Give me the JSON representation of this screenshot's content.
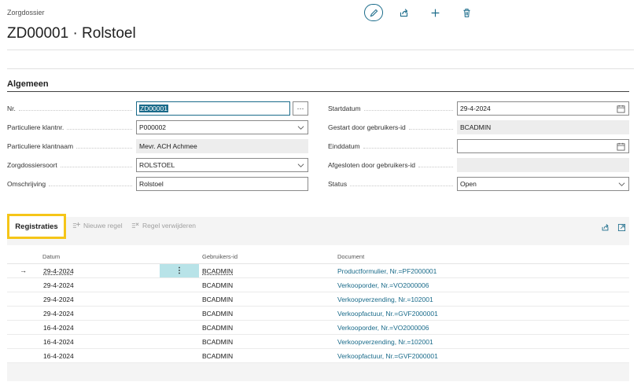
{
  "header": {
    "breadcrumb": "Zorgdossier",
    "title": "ZD00001 · Rolstoel",
    "actions": [
      {
        "icon": "pencil-icon",
        "label": "Bewerken"
      },
      {
        "icon": "share-icon",
        "label": "Delen"
      },
      {
        "icon": "plus-icon",
        "label": "Nieuw"
      },
      {
        "icon": "trash-icon",
        "label": "Verwijderen"
      }
    ]
  },
  "general": {
    "title": "Algemeen",
    "left": [
      {
        "label": "Nr.",
        "value": "ZD00001"
      },
      {
        "label": "Particuliere klantnr.",
        "value": "P000002"
      },
      {
        "label": "Particuliere klantnaam",
        "value": "Mevr. ACH Achmee"
      },
      {
        "label": "Zorgdossiersoort",
        "value": "ROLSTOEL"
      },
      {
        "label": "Omschrijving",
        "value": "Rolstoel"
      }
    ],
    "right": [
      {
        "label": "Startdatum",
        "value": "29-4-2024"
      },
      {
        "label": "Gestart door gebruikers-id",
        "value": "BCADMIN"
      },
      {
        "label": "Einddatum",
        "value": ""
      },
      {
        "label": "Afgesloten door gebruikers-id",
        "value": ""
      },
      {
        "label": "Status",
        "value": "Open"
      }
    ],
    "more_label": "···"
  },
  "registraties": {
    "tab_label": "Registraties",
    "new_line_label": "Nieuwe regel",
    "delete_line_label": "Regel verwijderen",
    "columns": {
      "date": "Datum",
      "user": "Gebruikers-id",
      "document": "Document"
    },
    "current_marker": "→",
    "row_menu": "⋮",
    "rows": [
      {
        "date": "29-4-2024",
        "user": "BCADMIN",
        "document": "Productformulier, Nr.=PF2000001"
      },
      {
        "date": "29-4-2024",
        "user": "BCADMIN",
        "document": "Verkooporder, Nr.=VO2000006"
      },
      {
        "date": "29-4-2024",
        "user": "BCADMIN",
        "document": "Verkoopverzending, Nr.=102001"
      },
      {
        "date": "29-4-2024",
        "user": "BCADMIN",
        "document": "Verkoopfactuur, Nr.=GVF2000001"
      },
      {
        "date": "16-4-2024",
        "user": "BCADMIN",
        "document": "Verkooporder, Nr.=VO2000006"
      },
      {
        "date": "16-4-2024",
        "user": "BCADMIN",
        "document": "Verkoopverzending, Nr.=102001"
      },
      {
        "date": "16-4-2024",
        "user": "BCADMIN",
        "document": "Verkoopfactuur, Nr.=GVF2000001"
      }
    ]
  },
  "colors": {
    "accent": "#1a6b8a",
    "highlight": "#f5c518",
    "row_select": "#b8e3e8"
  }
}
